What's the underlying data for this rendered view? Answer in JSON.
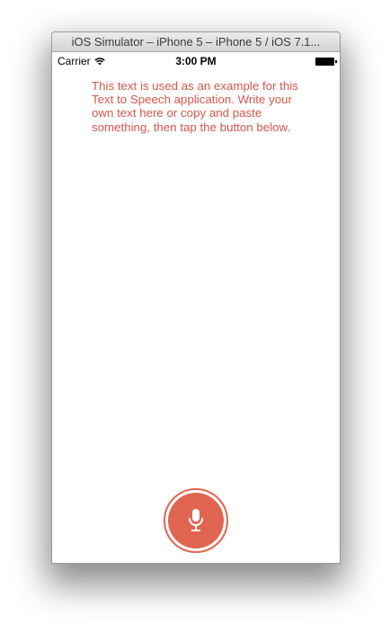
{
  "window": {
    "title": "iOS Simulator – iPhone 5 – iPhone 5 / iOS 7.1..."
  },
  "statusbar": {
    "carrier": "Carrier",
    "time": "3:00 PM"
  },
  "content": {
    "text": "This text is used as an example for this Text to Speech application. Write your own text here or copy and paste something, then tap the button below."
  },
  "icons": {
    "wifi": "wifi-icon",
    "battery": "battery-icon",
    "microphone": "microphone-icon"
  },
  "colors": {
    "accent": "#e06550",
    "text": "#d9564a"
  }
}
